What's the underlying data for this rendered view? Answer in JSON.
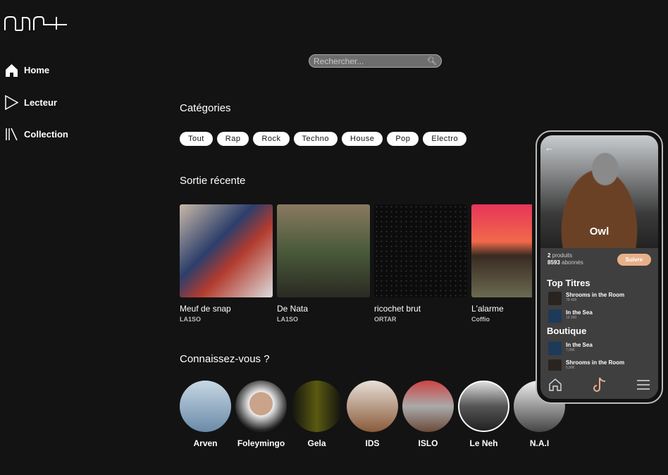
{
  "app": {
    "logo_text": "num+"
  },
  "sidebar": {
    "items": [
      {
        "label": "Home",
        "icon": "home-icon"
      },
      {
        "label": "Lecteur",
        "icon": "play-icon"
      },
      {
        "label": "Collection",
        "icon": "library-icon"
      }
    ]
  },
  "search": {
    "placeholder": "Rechercher...",
    "value": ""
  },
  "categories": {
    "title": "Catégories",
    "items": [
      "Tout",
      "Rap",
      "Rock",
      "Techno",
      "House",
      "Pop",
      "Electro"
    ]
  },
  "recent": {
    "title": "Sortie récente",
    "items": [
      {
        "title": "Meuf de snap",
        "artist": "LA1SO"
      },
      {
        "title": "De Nata",
        "artist": "LA1SO"
      },
      {
        "title": "ricochet brut",
        "artist": "ORTAR"
      },
      {
        "title": "L'alarme",
        "artist": "Coffio"
      }
    ]
  },
  "discover": {
    "title": "Connaissez-vous ?",
    "items": [
      "Arven",
      "Foleymingo",
      "Gela",
      "IDS",
      "ISLO",
      "Le Neh",
      "N.A.I"
    ]
  },
  "phone": {
    "artist": "Owl",
    "products": "2",
    "products_label": "produits",
    "followers": "8593",
    "followers_label": "abonnés",
    "follow_label": "Suivre",
    "top_title": "Top Titres",
    "top": [
      {
        "name": "Shrooms in the Room",
        "sub": "78 499"
      },
      {
        "name": "In the Sea",
        "sub": "19 260"
      }
    ],
    "shop_title": "Boutique",
    "shop": [
      {
        "name": "In the Sea",
        "sub": "7,99€"
      },
      {
        "name": "Shrooms in the Room",
        "sub": "5,99€"
      }
    ],
    "accent": "#e8b08a"
  }
}
